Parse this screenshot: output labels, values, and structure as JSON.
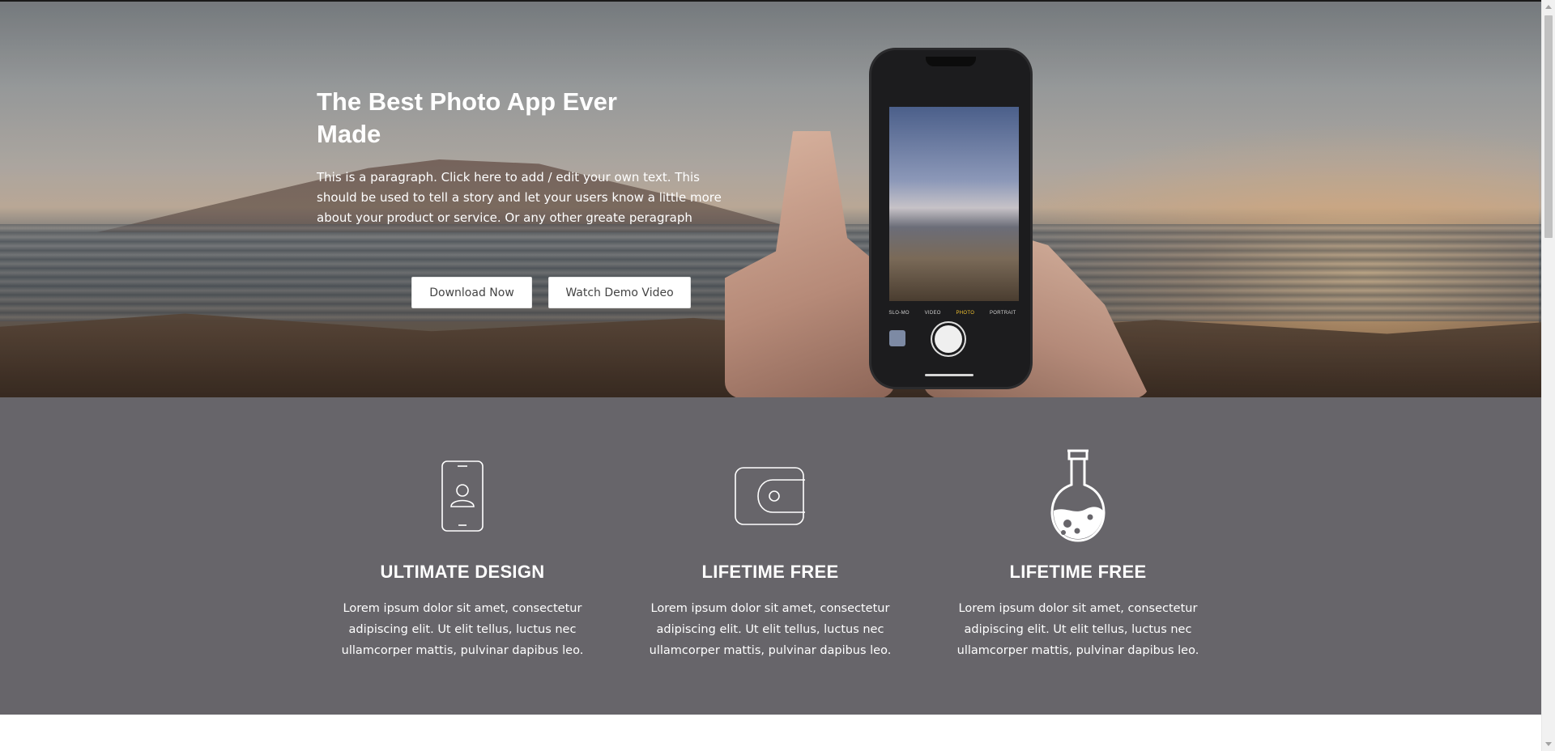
{
  "hero": {
    "title": "The Best Photo App Ever Made",
    "paragraph": "This is a paragraph. Click here to add / edit your own text. This should be used to tell a story and let your users know a little more about your product or service. Or any other greate peragraph",
    "download_label": "Download Now",
    "demo_label": "Watch Demo Video",
    "phone_modes": [
      "SLO-MO",
      "VIDEO",
      "PHOTO",
      "PORTRAIT"
    ]
  },
  "features": [
    {
      "icon": "smartphone-user-icon",
      "title": "ULTIMATE DESIGN",
      "text": "Lorem ipsum dolor sit amet, consectetur adipiscing elit. Ut elit tellus, luctus nec ullamcorper mattis, pulvinar dapibus leo."
    },
    {
      "icon": "wallet-icon",
      "title": "LIFETIME FREE",
      "text": "Lorem ipsum dolor sit amet, consectetur adipiscing elit. Ut elit tellus, luctus nec ullamcorper mattis, pulvinar dapibus leo."
    },
    {
      "icon": "flask-icon",
      "title": "LIFETIME FREE",
      "text": "Lorem ipsum dolor sit amet, consectetur adipiscing elit. Ut elit tellus, luctus nec ullamcorper mattis, pulvinar dapibus leo."
    }
  ],
  "colors": {
    "features_background": "#67656a",
    "button_background": "#ffffff",
    "button_text": "#444444"
  }
}
